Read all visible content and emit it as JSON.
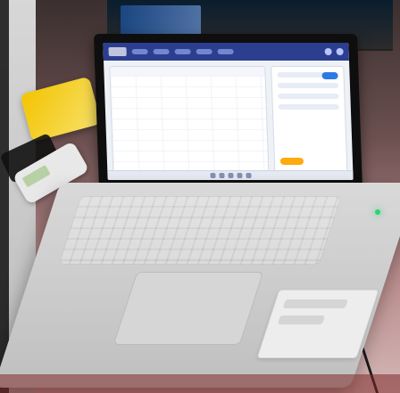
{
  "scene": {
    "description": "",
    "screen_content": {
      "app_header_items": [
        "",
        "",
        "",
        "",
        "",
        ""
      ]
    },
    "snack_pack": {
      "text": ""
    }
  },
  "colors": {
    "screen_header": "#2c3e8f",
    "screen_bg": "#eef2f7",
    "accent_blue": "#2c7be5",
    "accent_orange": "#ffa500"
  }
}
